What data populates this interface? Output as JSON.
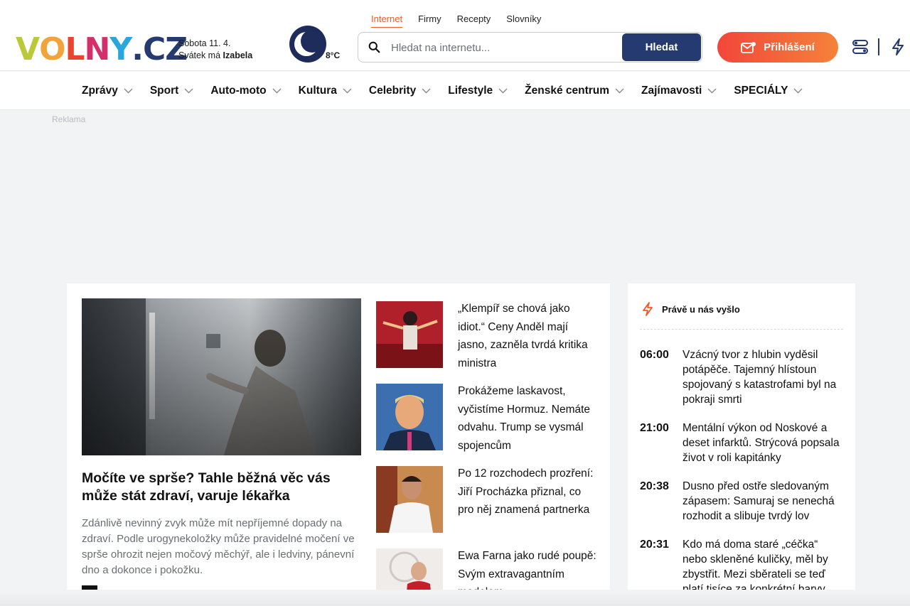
{
  "brand": {
    "logo_letters": [
      {
        "char": "V",
        "color": "#b9c93a"
      },
      {
        "char": "O",
        "color": "#f2a33a"
      },
      {
        "char": "L",
        "color": "#e8452c"
      },
      {
        "char": "N",
        "color": "#d3306a"
      },
      {
        "char": "Y",
        "color": "#2aa6de"
      },
      {
        "char": ".",
        "color": "#243a70"
      },
      {
        "char": "C",
        "color": "#243a70"
      },
      {
        "char": "Z",
        "color": "#243a70"
      }
    ]
  },
  "header": {
    "date_line": "Sobota 11. 4.",
    "nameday_prefix": "Svátek má ",
    "nameday_name": "Izabela",
    "temperature": "8°C",
    "weather_icon": "moon-icon",
    "top_nav": [
      {
        "label": "Internet",
        "active": true
      },
      {
        "label": "Firmy",
        "active": false
      },
      {
        "label": "Recepty",
        "active": false
      },
      {
        "label": "Slovníky",
        "active": false
      }
    ],
    "search_placeholder": "Hledat na internetu...",
    "search_button": "Hledat",
    "login_button": "Přihlášení",
    "accent_color": "#f05a28",
    "brand_blue": "#243a70"
  },
  "main_nav": [
    "Zprávy",
    "Sport",
    "Auto-moto",
    "Kultura",
    "Celebrity",
    "Lifestyle",
    "Ženské centrum",
    "Zajímavosti",
    "SPECIÁLY"
  ],
  "ad_label": "Reklama",
  "hero": {
    "title": "Močíte ve sprše? Tahle běžná věc vás může stát zdraví, varuje lékařka",
    "perex": "Zdánlivě nevinný zvyk může mít nepříjemné dopady na zdraví. Podle urogynekoložky může pravidelné močení ve sprše ohrozit nejen močový měchýř, ale i ledviny, pánevní dno a dokonce i pokožku."
  },
  "side_articles": [
    {
      "title": "„Klempíř se chová jako idiot.“ Ceny Anděl mají jasno, zazněla tvrdá kritika ministra"
    },
    {
      "title": "Prokážeme laskavost, vyčistíme Hormuz. Nemáte odvahu. Trump se vysmál spojencům"
    },
    {
      "title": "Po 12 rozchodech prozření: Jiří Procházka přiznal, co pro něj znamená partnerka"
    },
    {
      "title": "Ewa Farna jako rudé poupě: Svým extravagantním modelem"
    }
  ],
  "feed": {
    "heading": "Právě u nás vyšlo",
    "items": [
      {
        "time": "06:00",
        "text": "Vzácný tvor z hlubin vyděsil potápěče. Tajemný hlístoun spojovaný s katastrofami byl na pokraji smrti"
      },
      {
        "time": "21:00",
        "text": "Mentální výkon od Noskové a deset infarktů. Strýcová popsala život v roli kapitánky"
      },
      {
        "time": "20:38",
        "text": "Dusno před ostře sledovaným zápasem: Samuraj se nenechá rozhodit a slibuje tvrdý lov"
      },
      {
        "time": "20:31",
        "text": "Kdo má doma staré „céčka“ nebo skleněné kuličky, měl by zbystřit. Mezi sběrateli se teď platí tisíce za konkrétní barvy"
      }
    ]
  }
}
